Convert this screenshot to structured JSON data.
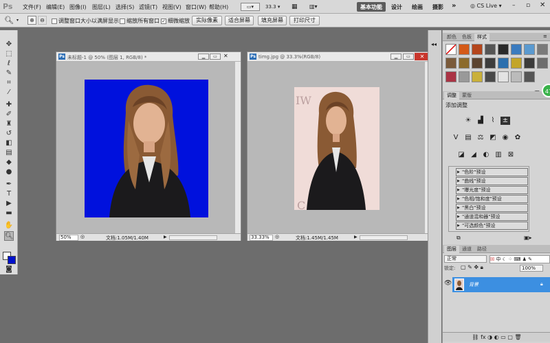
{
  "app": {
    "logo": "Ps"
  },
  "menu": [
    "文件(F)",
    "编辑(E)",
    "图像(I)",
    "图层(L)",
    "选择(S)",
    "滤镜(T)",
    "视图(V)",
    "窗口(W)",
    "帮助(H)"
  ],
  "zoom_select": "33.3",
  "workspaces": {
    "basic": "基本功能",
    "design": "设计",
    "paint": "绘画",
    "photo": "摄影",
    "more": "»"
  },
  "cslive": "CS Live",
  "options": {
    "resize_windows": "调整窗口大小以满屏显示",
    "zoom_all": "缩放所有窗口",
    "scrubby_zoom": "细微缩放",
    "actual_pixels": "实际像素",
    "fit_screen": "适合屏幕",
    "fill_screen": "填充屏幕",
    "print_size": "打印尺寸"
  },
  "doc1": {
    "icon": "Ps",
    "title": "未标题-1 @ 50% (图层 1, RGB/8) *",
    "zoom": "50%",
    "status": "文档:1.05M/1.40M",
    "canvas_color": "#0011dd"
  },
  "doc2": {
    "icon": "Ps",
    "title": "timg.jpg @ 33.3%(RGB/8)",
    "zoom": "33.33%",
    "status": "文档:1.45M/1.45M",
    "canvas_color": "#f0dcd8"
  },
  "styles_panel": {
    "tabs": [
      "颜色",
      "色板",
      "样式"
    ]
  },
  "adjust_panel": {
    "tabs": [
      "调整",
      "蒙版"
    ],
    "header": "添加调整",
    "presets": [
      "\"色阶\"预设",
      "\"曲线\"预设",
      "\"曝光度\"预设",
      "\"色相/饱和度\"预设",
      "\"黑白\"预设",
      "\"通道混和器\"预设",
      "\"可选颜色\"预设"
    ]
  },
  "layers_panel": {
    "tabs": [
      "图层",
      "通道",
      "路径"
    ],
    "blend_mode": "正常",
    "lock_label": "锁定:",
    "opacity": "100%",
    "ime": "中",
    "layer_name": "背景"
  },
  "badge": "47",
  "colors": {
    "accent": "#3c8fe1",
    "doc1_canvas": "#0011dd"
  }
}
